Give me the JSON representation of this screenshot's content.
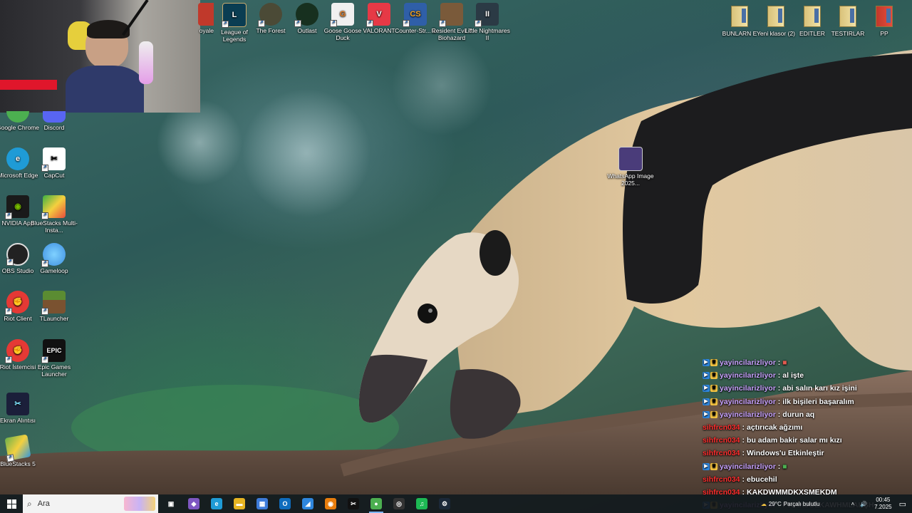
{
  "desktop": {
    "top_icons": [
      {
        "label": "oyale",
        "icon": "clash-royale-icon",
        "color": "#c0392b"
      },
      {
        "label": "League of Legends",
        "icon": "league-of-legends-icon",
        "color": "#0a3d52"
      },
      {
        "label": "The Forest",
        "icon": "the-forest-icon",
        "color": "#4b4a36"
      },
      {
        "label": "Outlast",
        "icon": "outlast-icon",
        "color": "#17301f"
      },
      {
        "label": "Goose Goose Duck",
        "icon": "goose-goose-duck-icon",
        "color": "#f0f0f0"
      },
      {
        "label": "VALORANT",
        "icon": "valorant-icon",
        "color": "#e63946"
      },
      {
        "label": "Counter-Str... 2",
        "icon": "counter-strike-icon",
        "color": "#2f5fa8"
      },
      {
        "label": "Resident Evil 7 Biohazard",
        "icon": "resident-evil-icon",
        "color": "#7a5a3a"
      },
      {
        "label": "Little Nightmares II",
        "icon": "little-nightmares-icon",
        "color": "#2b3a45"
      }
    ],
    "right_folders": [
      {
        "label": "BUNLARN E"
      },
      {
        "label": "Yeni klasor (2)"
      },
      {
        "label": "EDITLER"
      },
      {
        "label": "TESTIRLAR"
      },
      {
        "label": "PP"
      }
    ],
    "left_icons": [
      {
        "label": "Google Chrome",
        "icon": "google-chrome-icon",
        "color": "#4caf50"
      },
      {
        "label": "Discord",
        "icon": "discord-icon",
        "color": "#5865f2"
      },
      {
        "label": "Microsoft Edge",
        "icon": "microsoft-edge-icon",
        "color": "#1f9bd6"
      },
      {
        "label": "CapCut",
        "icon": "capcut-icon",
        "color": "#ffffff"
      },
      {
        "label": "NVIDIA App",
        "icon": "nvidia-icon",
        "color": "#1a1a1a"
      },
      {
        "label": "BlueStacks Multi-Insta...",
        "icon": "bluestacks-multi-icon",
        "color": "#3cb043"
      },
      {
        "label": "OBS Studio",
        "icon": "obs-studio-icon",
        "color": "#222222"
      },
      {
        "label": "Gameloop",
        "icon": "gameloop-icon",
        "color": "#3e8fe0"
      },
      {
        "label": "Riot Client",
        "icon": "riot-client-icon",
        "color": "#e53935"
      },
      {
        "label": "TLauncher",
        "icon": "tlauncher-icon",
        "color": "#5b8c32"
      },
      {
        "label": "Riot İstemcisi",
        "icon": "riot-istemcisi-icon",
        "color": "#e53935"
      },
      {
        "label": "Epic Games Launcher",
        "icon": "epic-games-icon",
        "color": "#111111"
      },
      {
        "label": "Ekran Alıntısı",
        "icon": "snipping-tool-icon",
        "color": "#1b1f3a"
      },
      {
        "label": "BlueStacks 5",
        "icon": "bluestacks-icon",
        "color": "#6ab04c"
      }
    ],
    "file_icon": {
      "label": "WhatsApp Image 2025...",
      "icon": "image-file-icon"
    }
  },
  "chat": {
    "lines": [
      {
        "user": "yayincilarizliyor",
        "msg": "",
        "color": "purple",
        "badges": true
      },
      {
        "user": "yayincilarizliyor",
        "msg": "al işte",
        "color": "purple",
        "badges": true
      },
      {
        "user": "yayincilarizliyor",
        "msg": "abi salın karı kız işini",
        "color": "purple",
        "badges": true
      },
      {
        "user": "yayincilarizliyor",
        "msg": "ilk bişileri başaralım",
        "color": "purple",
        "badges": true
      },
      {
        "user": "yayincilarizliyor",
        "msg": "durun aq",
        "color": "purple",
        "badges": true
      },
      {
        "user": "sihfrcn034",
        "msg": "açtırıcak ağzımı",
        "color": "red",
        "badges": false
      },
      {
        "user": "sihfrcn034",
        "msg": "bu adam bakir salar mı kızı",
        "color": "red",
        "badges": false
      },
      {
        "user": "sihfrcn034",
        "msg": "Windows'u Etkinleştir",
        "color": "red",
        "badges": false
      },
      {
        "user": "yayincilarizliyor",
        "msg": "",
        "color": "purple",
        "badges": true
      },
      {
        "user": "sihfrcn034",
        "msg": "ebucehil",
        "color": "red",
        "badges": false
      },
      {
        "user": "sihfrcn034",
        "msg": "KAKDWMMDKXSMEKDM",
        "color": "red",
        "badges": false
      },
      {
        "user": "yayincilarizliyor",
        "msg": "FWAKJGLKAWHMLAKŞH",
        "color": "purple",
        "badges": true
      }
    ],
    "colors": {
      "purple": "#c9a3ff",
      "red": "#ff2e2e"
    }
  },
  "taskbar": {
    "search_placeholder": "Ara",
    "apps": [
      {
        "name": "task-view-icon",
        "glyph": "▣",
        "color": "transparent"
      },
      {
        "name": "copilot-icon",
        "glyph": "◆",
        "color": "#7e57c2"
      },
      {
        "name": "edge-icon",
        "glyph": "e",
        "color": "#1f9bd6"
      },
      {
        "name": "file-explorer-icon",
        "glyph": "▬",
        "color": "#e6b422"
      },
      {
        "name": "store-icon",
        "glyph": "▦",
        "color": "#3d7bd9"
      },
      {
        "name": "outlook-icon",
        "glyph": "O",
        "color": "#0f6cbd"
      },
      {
        "name": "app-icon",
        "glyph": "◢",
        "color": "#2e86de"
      },
      {
        "name": "blender-icon",
        "glyph": "◉",
        "color": "#e87d0d"
      },
      {
        "name": "capcut-icon",
        "glyph": "✂",
        "color": "#111111"
      },
      {
        "name": "chrome-icon",
        "glyph": "●",
        "color": "#4caf50",
        "active": true
      },
      {
        "name": "obs-icon",
        "glyph": "◎",
        "color": "#333333"
      },
      {
        "name": "spotify-icon",
        "glyph": "♫",
        "color": "#1db954"
      },
      {
        "name": "steam-icon",
        "glyph": "⚙",
        "color": "#1b2838"
      }
    ],
    "weather": "29°C",
    "weather_desc": "Parçalı bulutlu",
    "time": "00:45",
    "date": "7.2025"
  }
}
